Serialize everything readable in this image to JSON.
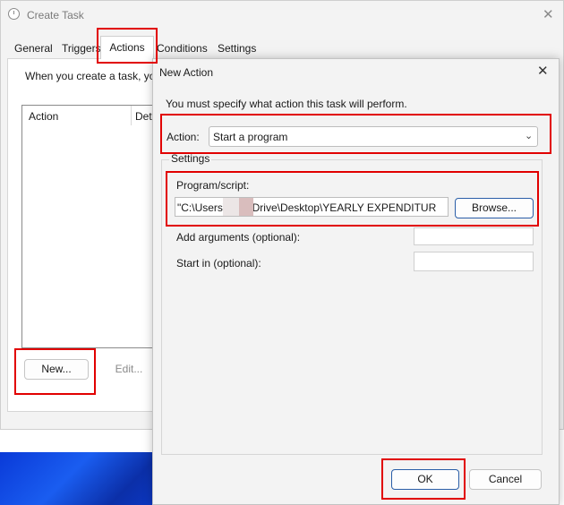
{
  "create_task": {
    "title": "Create Task",
    "tabs": [
      "General",
      "Triggers",
      "Actions",
      "Conditions",
      "Settings"
    ],
    "active_tab": "Actions",
    "description": "When you create a task, yo",
    "columns": [
      "Action",
      "Det"
    ],
    "new_button": "New...",
    "edit_button": "Edit..."
  },
  "new_action": {
    "title": "New Action",
    "instruction": "You must specify what action this task will perform.",
    "action_label": "Action:",
    "action_value": "Start a program",
    "settings_label": "Settings",
    "program_label": "Program/script:",
    "program_value": "\"C:\\Users\\        .OneDrive\\Desktop\\YEARLY EXPENDITUR",
    "browse_button": "Browse...",
    "args_label": "Add arguments (optional):",
    "args_value": "",
    "start_label": "Start in (optional):",
    "start_value": "",
    "ok_button": "OK",
    "cancel_button": "Cancel"
  },
  "colors": {
    "highlight": "#e10000",
    "accent": "#2a5ea8"
  }
}
